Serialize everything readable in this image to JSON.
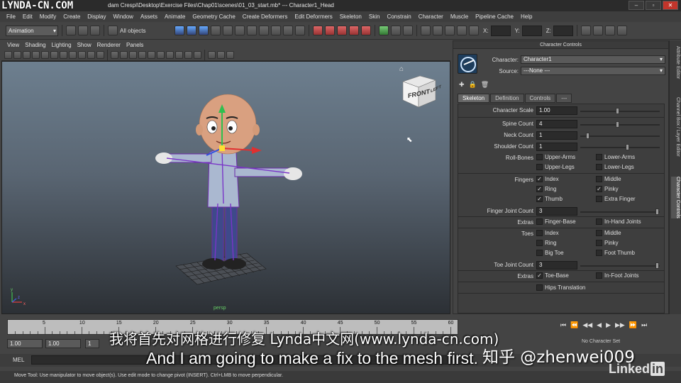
{
  "watermark_top": "LYNDA-CN.COM",
  "window": {
    "title": "dam Crespi\\Desktop\\Exercise Files\\Chap01\\scenes\\01_03_start.mb*   ---   Character1_Head",
    "min": "–",
    "max": "▫",
    "close": "✕"
  },
  "menubar": [
    "File",
    "Edit",
    "Modify",
    "Create",
    "Display",
    "Window",
    "Assets",
    "Animate",
    "Geometry Cache",
    "Create Deformers",
    "Edit Deformers",
    "Skeleton",
    "Skin",
    "Constrain",
    "Character",
    "Muscle",
    "Pipeline Cache",
    "Help"
  ],
  "toolbar": {
    "mode": "Animation",
    "selection": "All objects",
    "coords": [
      "X:",
      "Y:",
      "Z:"
    ]
  },
  "viewport": {
    "menu": [
      "View",
      "Shading",
      "Lighting",
      "Show",
      "Renderer",
      "Panels"
    ],
    "cube_label": "FRONT",
    "cube_side": "LEFT",
    "camera_label": "persp",
    "axis_labels": [
      "y",
      "z",
      "x"
    ]
  },
  "character_controls": {
    "title": "Character Controls",
    "character_label": "Character:",
    "character_value": "Character1",
    "source_label": "Source:",
    "source_value": "---None ---",
    "tabs": [
      "Skeleton",
      "Definition",
      "Controls",
      "---"
    ],
    "active_tab": "Skeleton",
    "character_scale_label": "Character Scale",
    "character_scale": "1.00",
    "character_scale_level": 0.47,
    "spine_label": "Spine Count",
    "spine_count": "4",
    "spine_level": 0.47,
    "neck_label": "Neck Count",
    "neck_count": "1",
    "neck_level": 0.08,
    "shoulder_label": "Shoulder Count",
    "shoulder_count": "1",
    "shoulder_level": 0.6,
    "rollbones_label": "Roll-Bones",
    "rollbones": [
      {
        "label": "Upper-Arms",
        "checked": false
      },
      {
        "label": "Lower-Arms",
        "checked": false
      },
      {
        "label": "Upper-Legs",
        "checked": false
      },
      {
        "label": "Lower-Legs",
        "checked": false
      }
    ],
    "fingers_label": "Fingers",
    "fingers": [
      {
        "label": "Index",
        "checked": true
      },
      {
        "label": "Middle",
        "checked": false
      },
      {
        "label": "Ring",
        "checked": true
      },
      {
        "label": "Pinky",
        "checked": true
      },
      {
        "label": "Thumb",
        "checked": true
      },
      {
        "label": "Extra Finger",
        "checked": false
      }
    ],
    "finger_joint_label": "Finger Joint Count",
    "finger_joint_count": "3",
    "finger_joint_level": 1.0,
    "extras_label": "Extras",
    "finger_extras": [
      {
        "label": "Finger-Base",
        "checked": false
      },
      {
        "label": "In-Hand Joints",
        "checked": false
      }
    ],
    "toes_label": "Toes",
    "toes": [
      {
        "label": "Index",
        "checked": false
      },
      {
        "label": "Middle",
        "checked": false
      },
      {
        "label": "Ring",
        "checked": false
      },
      {
        "label": "Pinky",
        "checked": false
      },
      {
        "label": "Big Toe",
        "checked": false
      },
      {
        "label": "Foot Thumb",
        "checked": false
      }
    ],
    "toe_joint_label": "Toe Joint Count",
    "toe_joint_count": "3",
    "toe_joint_level": 1.0,
    "toe_extras": [
      {
        "label": "Toe-Base",
        "checked": true
      },
      {
        "label": "In-Foot Joints",
        "checked": false
      }
    ],
    "hips_translation": {
      "label": "Hips Translation",
      "checked": false
    }
  },
  "side_tabs": [
    "Attribute Editor",
    "Channel Box / Layer Editor",
    "Character Controls"
  ],
  "timeline": {
    "ticks": [
      "5",
      "10",
      "15",
      "20",
      "25",
      "30",
      "35",
      "40",
      "45",
      "50",
      "55",
      "60"
    ],
    "range_start": "1.00",
    "range_inner": "1.00",
    "range_mid": "1",
    "character_set": "No Character Set",
    "play_icons": [
      "⏮",
      "⏪",
      "◀◀",
      "◀",
      "▶",
      "▶▶",
      "⏩",
      "⏭"
    ]
  },
  "mel_label": "MEL",
  "helpline": "Move Tool: Use manipulator to move object(s). Use edit mode to change pivot (INSERT). Ctrl+LMB to move perpendicular.",
  "subtitles": {
    "cn": "我将首先对网格进行修复 Lynda中文网(www.lynda-cn.com)",
    "en": "And I am going to make a fix to the mesh first."
  },
  "zhihu_mark": "知乎 @zhenwei009",
  "linkedin": "Linked",
  "linkedin_in": "in"
}
